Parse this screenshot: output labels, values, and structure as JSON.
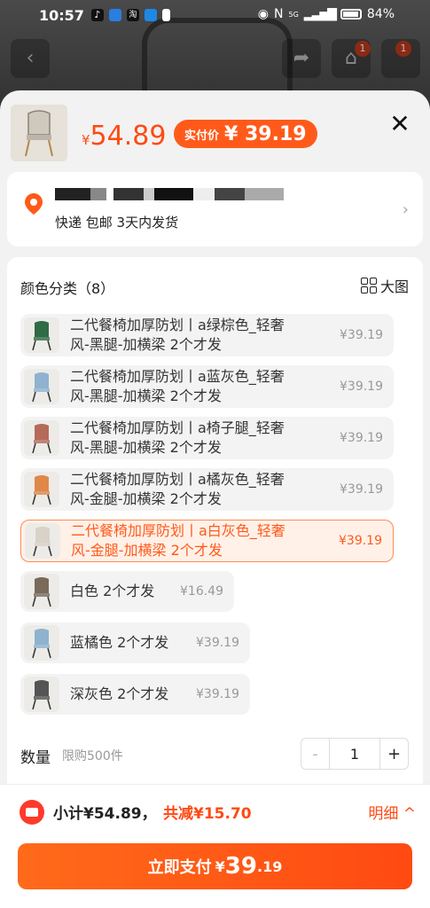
{
  "status_bar": {
    "time": "10:57",
    "battery": "84%",
    "signal": "5G"
  },
  "background": {
    "cart_badge": "1",
    "message_badge": "1"
  },
  "header": {
    "currency": "¥",
    "price": "54.89",
    "pay_label": "实付价",
    "pay_price": "¥ 39.19"
  },
  "address": {
    "shipping_text": "快递 包邮 3天内发货"
  },
  "spec": {
    "title": "颜色分类（8）",
    "big_image_label": "大图",
    "options": [
      {
        "line1": "二代餐椅加厚防划丨a绿棕色_轻奢",
        "line2": "风-黑腿-加横梁 2个才发",
        "price": "¥39.19",
        "color": "#2f6b45",
        "selected": false
      },
      {
        "line1": "二代餐椅加厚防划丨a蓝灰色_轻奢",
        "line2": "风-黑腿-加横梁 2个才发",
        "price": "¥39.19",
        "color": "#8fb2cf",
        "selected": false
      },
      {
        "line1": "二代餐椅加厚防划丨a椅子腿_轻奢",
        "line2": "风-黑腿-加横梁 2个才发",
        "price": "¥39.19",
        "color": "#b56a5a",
        "selected": false
      },
      {
        "line1": "二代餐椅加厚防划丨a橘灰色_轻奢",
        "line2": "风-金腿-加横梁 2个才发",
        "price": "¥39.19",
        "color": "#e0874a",
        "selected": false
      },
      {
        "line1": "二代餐椅加厚防划丨a白灰色_轻奢",
        "line2": "风-金腿-加横梁 2个才发",
        "price": "¥39.19",
        "color": "#d8d2c8",
        "selected": true
      }
    ],
    "short_options": [
      {
        "label": "白色 2个才发",
        "price": "¥16.49",
        "color": "#7a6a5a"
      },
      {
        "label": "蓝橘色 2个才发",
        "price": "¥39.19",
        "color": "#8fb2cf"
      },
      {
        "label": "深灰色 2个才发",
        "price": "¥39.19",
        "color": "#555555"
      }
    ]
  },
  "quantity": {
    "label": "数量",
    "limit": "限购500件",
    "value": "1",
    "minus": "-",
    "plus": "+"
  },
  "footer": {
    "subtotal": "小计¥54.89，",
    "discount": "共减¥15.70",
    "detail": "明细 ^",
    "pay_label": "立即支付",
    "pay_currency": "¥",
    "pay_int": "39",
    "pay_dec": ".19"
  },
  "colors": {
    "accent": "#ff4a12",
    "selected_bg": "#fff1e8"
  }
}
